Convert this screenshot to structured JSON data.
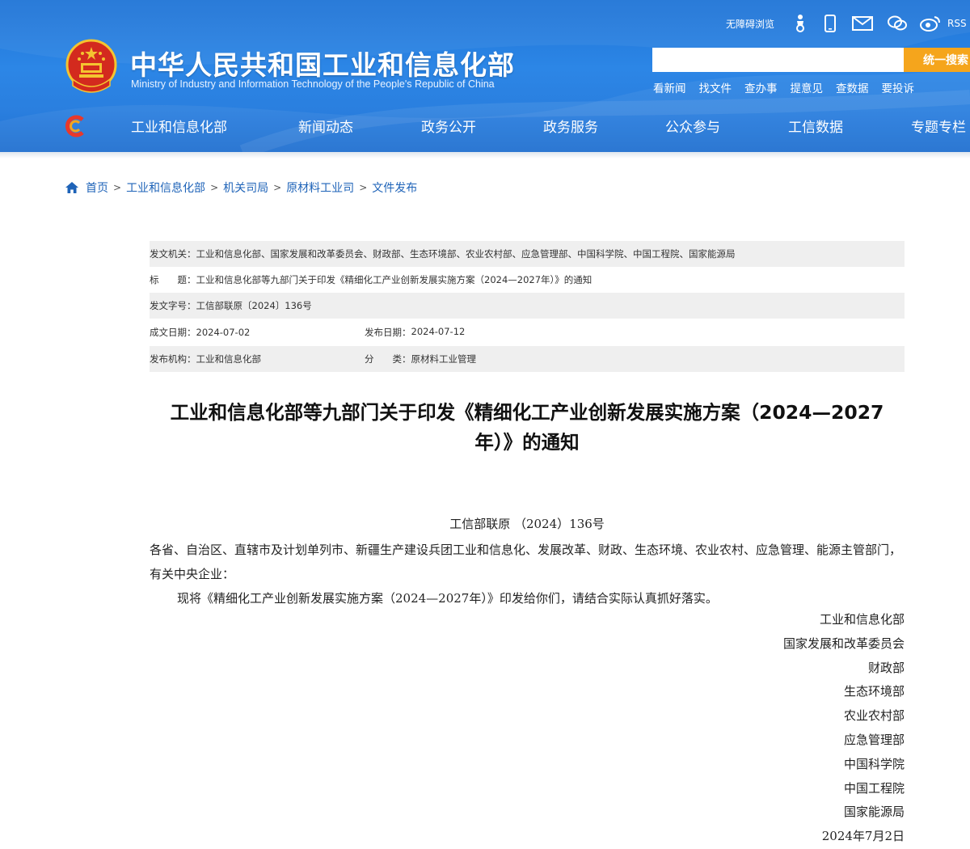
{
  "header": {
    "site_title": "中华人民共和国工业和信息化部",
    "site_subtitle": "Ministry of Industry and Information Technology of the People's Republic of China",
    "accessible_label": "无障碍浏览",
    "rss_label": "RSS",
    "search_placeholder": "",
    "search_button": "统一搜索",
    "quick_links": [
      "看新闻",
      "找文件",
      "查办事",
      "提意见",
      "查数据",
      "要投诉"
    ],
    "nav": [
      "工业和信息化部",
      "新闻动态",
      "政务公开",
      "政务服务",
      "公众参与",
      "工信数据",
      "专题专栏"
    ]
  },
  "breadcrumb": [
    "首页",
    "工业和信息化部",
    "机关司局",
    "原材料工业司",
    "文件发布"
  ],
  "meta": {
    "issuer_label": "发文机关：",
    "issuer": "工业和信息化部、国家发展和改革委员会、财政部、生态环境部、农业农村部、应急管理部、中国科学院、中国工程院、国家能源局",
    "title_label": "标　　题：",
    "title": "工业和信息化部等九部门关于印发《精细化工产业创新发展实施方案（2024—2027年）》的通知",
    "docno_label": "发文字号：",
    "docno": "工信部联原〔2024〕136号",
    "created_label": "成文日期：",
    "created": "2024-07-02",
    "published_label": "发布日期：",
    "published": "2024-07-12",
    "org_label": "发布机构：",
    "org": "工业和信息化部",
    "category_label": "分　　类：",
    "category": "原材料工业管理"
  },
  "article": {
    "title_line1": "工业和信息化部等九部门关于印发《精细化工产业创新发展实施方案（2024—2027",
    "title_line2": "年）》的通知",
    "doc_number": "工信部联原 （2024）136号",
    "salutation": "各省、自治区、直辖市及计划单列市、新疆生产建设兵团工业和信息化、发展改革、财政、生态环境、农业农村、应急管理、能源主管部门，有关中央企业：",
    "paragraph": "现将《精细化工产业创新发展实施方案（2024—2027年）》印发给你们，请结合实际认真抓好落实。",
    "signers": [
      "工业和信息化部",
      "国家发展和改革委员会",
      "财政部",
      "生态环境部",
      "农业农村部",
      "应急管理部",
      "中国科学院",
      "中国工程院",
      "国家能源局"
    ],
    "date": "2024年7月2日"
  },
  "colors": {
    "header_blue": "#2a7fdf",
    "search_orange": "#f5a51c",
    "link_blue": "#1e63b8",
    "meta_gray": "#efefef"
  }
}
